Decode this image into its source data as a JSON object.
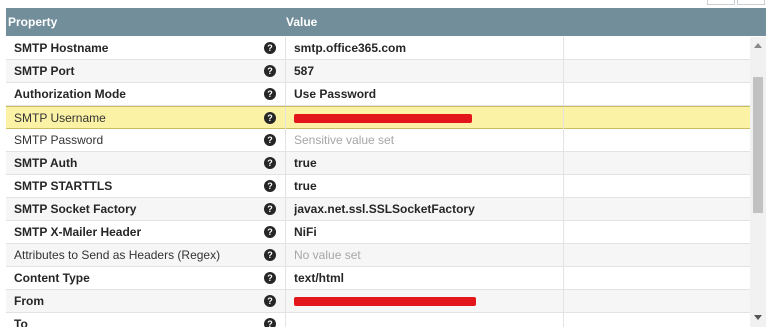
{
  "table": {
    "columns": {
      "property": "Property",
      "value": "Value"
    },
    "rows": [
      {
        "name": "SMTP Hostname",
        "value": "smtp.office365.com",
        "bold": true,
        "muted": false
      },
      {
        "name": "SMTP Port",
        "value": "587",
        "bold": true,
        "muted": false
      },
      {
        "name": "Authorization Mode",
        "value": "Use Password",
        "bold": true,
        "muted": false
      },
      {
        "name": "SMTP Username",
        "value": "",
        "bold": false,
        "muted": false,
        "selected": true,
        "redacted": true
      },
      {
        "name": "SMTP Password",
        "value": "Sensitive value set",
        "bold": false,
        "muted": true
      },
      {
        "name": "SMTP Auth",
        "value": "true",
        "bold": true,
        "muted": false
      },
      {
        "name": "SMTP STARTTLS",
        "value": "true",
        "bold": true,
        "muted": false
      },
      {
        "name": "SMTP Socket Factory",
        "value": "javax.net.ssl.SSLSocketFactory",
        "bold": true,
        "muted": false
      },
      {
        "name": "SMTP X-Mailer Header",
        "value": "NiFi",
        "bold": true,
        "muted": false
      },
      {
        "name": "Attributes to Send as Headers (Regex)",
        "value": "No value set",
        "bold": false,
        "muted": true
      },
      {
        "name": "Content Type",
        "value": "text/html",
        "bold": true,
        "muted": false
      },
      {
        "name": "From",
        "value": "",
        "bold": true,
        "muted": false,
        "redacted": true
      },
      {
        "name": "To",
        "value": "",
        "bold": true,
        "muted": false,
        "cut_off": true
      }
    ]
  },
  "icons": {
    "help": "question-circle-icon",
    "scroll_up": "arrow-up-icon",
    "scroll_down": "arrow-down-icon"
  },
  "colors": {
    "header_bg": "#728e9b",
    "selected_row": "#fbf2a6",
    "redaction": "#e2161b"
  }
}
